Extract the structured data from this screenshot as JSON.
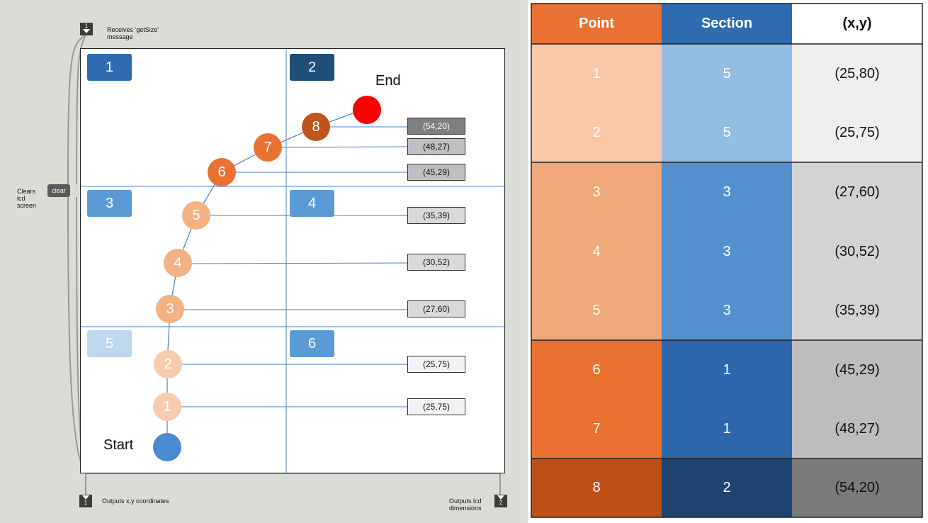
{
  "patcher": {
    "inlet_top_label": "Receives 'getSize' message",
    "inlet_top_num": "1",
    "clear_label": "Clears lcd screen",
    "clear_button": "clear",
    "outlet1_label": "Outputs x,y coordinates",
    "outlet1_num": "1",
    "outlet2_label": "Outputs lcd dimensions",
    "outlet2_num": "2"
  },
  "lcd": {
    "sections": [
      "1",
      "2",
      "3",
      "4",
      "5",
      "6"
    ],
    "start_label": "Start",
    "end_label": "End",
    "points": [
      {
        "label": "1",
        "coord": "(25,75)"
      },
      {
        "label": "2",
        "coord": "(25,75)"
      },
      {
        "label": "3",
        "coord": "(27,60)"
      },
      {
        "label": "4",
        "coord": "(30,52)"
      },
      {
        "label": "5",
        "coord": "(35,39)"
      },
      {
        "label": "6",
        "coord": "(45,29)"
      },
      {
        "label": "7",
        "coord": "(48,27)"
      },
      {
        "label": "8",
        "coord": "(54,20)"
      }
    ]
  },
  "table": {
    "headers": [
      "Point",
      "Section",
      "(x,y)"
    ],
    "rows": [
      [
        "1",
        "5",
        "(25,80)"
      ],
      [
        "2",
        "5",
        "(25,75)"
      ],
      [
        "3",
        "3",
        "(27,60)"
      ],
      [
        "4",
        "3",
        "(30,52)"
      ],
      [
        "5",
        "3",
        "(35,39)"
      ],
      [
        "6",
        "1",
        "(45,29)"
      ],
      [
        "7",
        "1",
        "(48,27)"
      ],
      [
        "8",
        "2",
        "(54,20)"
      ]
    ]
  },
  "colors": {
    "orange": "#e97132",
    "blue": "#2e6bb0",
    "light_orange": "#f5c6a5",
    "mid_orange": "#f0a878",
    "dark_orange": "#c0541b",
    "light_blue": "#9dc3e6",
    "mid_blue": "#5b9bd5",
    "dark_blue": "#1f4e79",
    "end_red": "#ff0000"
  }
}
